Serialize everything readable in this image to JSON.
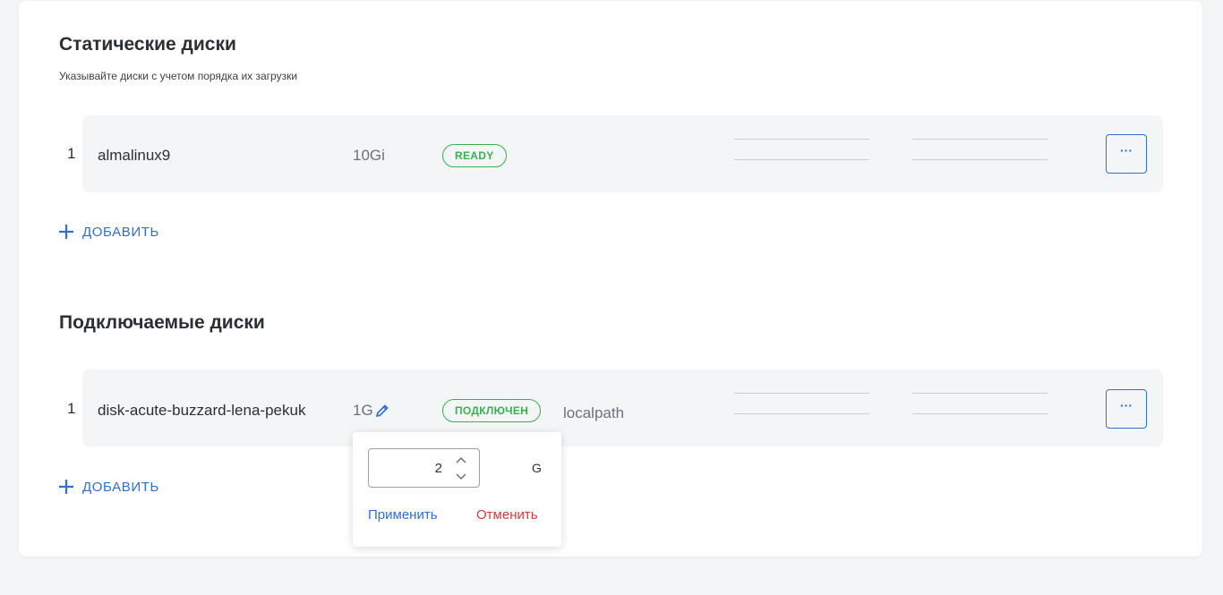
{
  "static_section": {
    "title": "Статические диски",
    "subtitle": "Указывайте диски с учетом порядка их загрузки",
    "disks": [
      {
        "index": "1",
        "name": "almalinux9",
        "size": "10Gi",
        "status": "READY"
      }
    ],
    "add_label": "ДОБАВИТЬ",
    "more_label": "···"
  },
  "attached_section": {
    "title": "Подключаемые диски",
    "disks": [
      {
        "index": "1",
        "name": "disk-acute-buzzard-lena-pekuk",
        "size": "1G",
        "status": "ПОДКЛЮЧЕН",
        "storage": "localpath"
      }
    ],
    "add_label": "ДОБАВИТЬ",
    "more_label": "···"
  },
  "resize_popover": {
    "value": "2",
    "unit": "G",
    "apply_label": "Применить",
    "cancel_label": "Отменить"
  },
  "colors": {
    "accent": "#2f6fd6",
    "success": "#37b24d",
    "danger": "#d63a3a",
    "row_bg": "#f4f5f7"
  },
  "icons": {
    "add": "plus-icon",
    "edit": "pencil-icon",
    "more": "ellipsis-icon",
    "spin_up": "chevron-up-icon",
    "spin_down": "chevron-down-icon"
  }
}
